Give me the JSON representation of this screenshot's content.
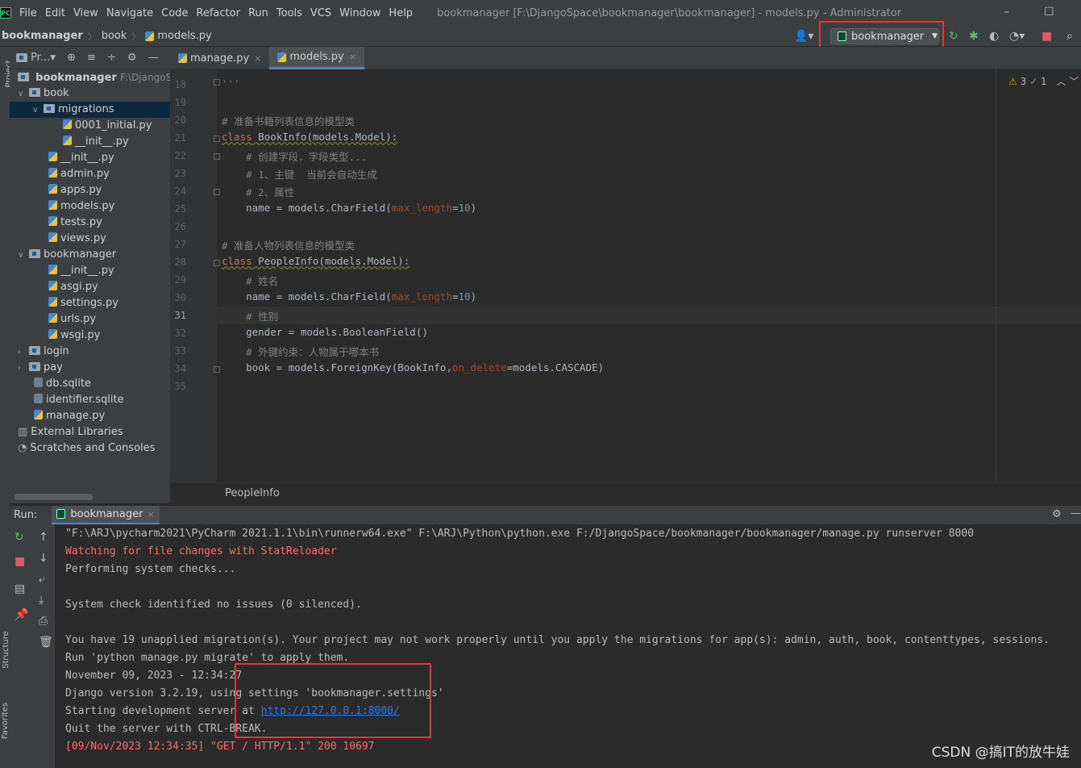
{
  "menubar": {
    "logo": "PC",
    "items": [
      "File",
      "Edit",
      "View",
      "Navigate",
      "Code",
      "Refactor",
      "Run",
      "Tools",
      "VCS",
      "Window",
      "Help"
    ],
    "window_title": "bookmanager [F:\\DjangoSpace\\bookmanager\\bookmanager] - models.py - Administrator",
    "minimize": "–",
    "maximize": "☐"
  },
  "navbar": {
    "crumbs": [
      "bookmanager",
      "book",
      "models.py"
    ],
    "run_config": "bookmanager"
  },
  "left_strip": {
    "project_tab": "Project",
    "structure_tab": "Structure",
    "favorites_tab": "Favorites"
  },
  "project": {
    "header": "Pr...",
    "root_label": "bookmanager",
    "root_path": "F:\\DjangoSpa",
    "items": [
      {
        "label": "book"
      },
      {
        "label": "migrations"
      },
      {
        "label": "0001_initial.py"
      },
      {
        "label": "__init__.py"
      },
      {
        "label": "__init__.py"
      },
      {
        "label": "admin.py"
      },
      {
        "label": "apps.py"
      },
      {
        "label": "models.py"
      },
      {
        "label": "tests.py"
      },
      {
        "label": "views.py"
      },
      {
        "label": "bookmanager"
      },
      {
        "label": "__init__.py"
      },
      {
        "label": "asgi.py"
      },
      {
        "label": "settings.py"
      },
      {
        "label": "urls.py"
      },
      {
        "label": "wsgi.py"
      },
      {
        "label": "login"
      },
      {
        "label": "pay"
      },
      {
        "label": "db.sqlite"
      },
      {
        "label": "identifier.sqlite"
      },
      {
        "label": "manage.py"
      },
      {
        "label": "External Libraries"
      },
      {
        "label": "Scratches and Consoles"
      }
    ]
  },
  "editor": {
    "tabs": [
      {
        "label": "manage.py"
      },
      {
        "label": "models.py"
      }
    ],
    "warnings": "3",
    "checks": "1",
    "line_numbers": [
      "18",
      "19",
      "20",
      "21",
      "22",
      "23",
      "24",
      "25",
      "26",
      "27",
      "28",
      "29",
      "30",
      "31",
      "32",
      "33",
      "34",
      "35"
    ],
    "code": {
      "l18": "'''",
      "l20": "# 准备书籍列表信息的模型类",
      "l21_kw": "class",
      "l21_rest": " BookInfo(models.Model):",
      "l22": "    # 创建字段，字段类型...",
      "l23": "    # 1、主键  当前会自动生成",
      "l24": "    # 2、属性",
      "l25_a": "    name = models.CharField(",
      "l25_p": "max_length",
      "l25_b": "=",
      "l25_n": "10",
      "l25_c": ")",
      "l27": "# 准备人物列表信息的模型类",
      "l28_kw": "class",
      "l28_rest": " PeopleInfo(models.Model):",
      "l29": "    # 姓名",
      "l30_a": "    name = models.CharField(",
      "l30_p": "max_length",
      "l30_b": "=",
      "l30_n": "10",
      "l30_c": ")",
      "l31": "    # 性别",
      "l32": "    gender = models.BooleanField()",
      "l33": "    # 外键约束：人物属于哪本书",
      "l34_a": "    book = models.ForeignKey(BookInfo,",
      "l34_p": "on_delete",
      "l34_b": "=models.CASCADE)"
    },
    "breadcrumb": "PeopleInfo"
  },
  "run": {
    "label": "Run:",
    "tab": "bookmanager",
    "lines": [
      "\"F:\\ARJ\\pycharm2021\\PyCharm 2021.1.1\\bin\\runnerw64.exe\" F:\\ARJ\\Python\\python.exe F:/DjangoSpace/bookmanager/bookmanager/manage.py runserver 8000",
      "Watching for file changes with StatReloader",
      "Performing system checks...",
      "System check identified no issues (0 silenced).",
      "You have 19 unapplied migration(s). Your project may not work properly until you apply the migrations for app(s): admin, auth, book, contenttypes, sessions.",
      "Run 'python manage.py migrate' to apply them.",
      "November 09, 2023 - 12:34:27",
      "Django version 3.2.19, using settings 'bookmanager.settings'",
      "Starting development server at ",
      "http://127.0.0.1:8000/",
      "Quit the server with CTRL-BREAK.",
      "[09/Nov/2023 12:34:35] \"GET / HTTP/1.1\" 200 10697"
    ]
  },
  "watermark": "CSDN @搞IT的放牛娃"
}
